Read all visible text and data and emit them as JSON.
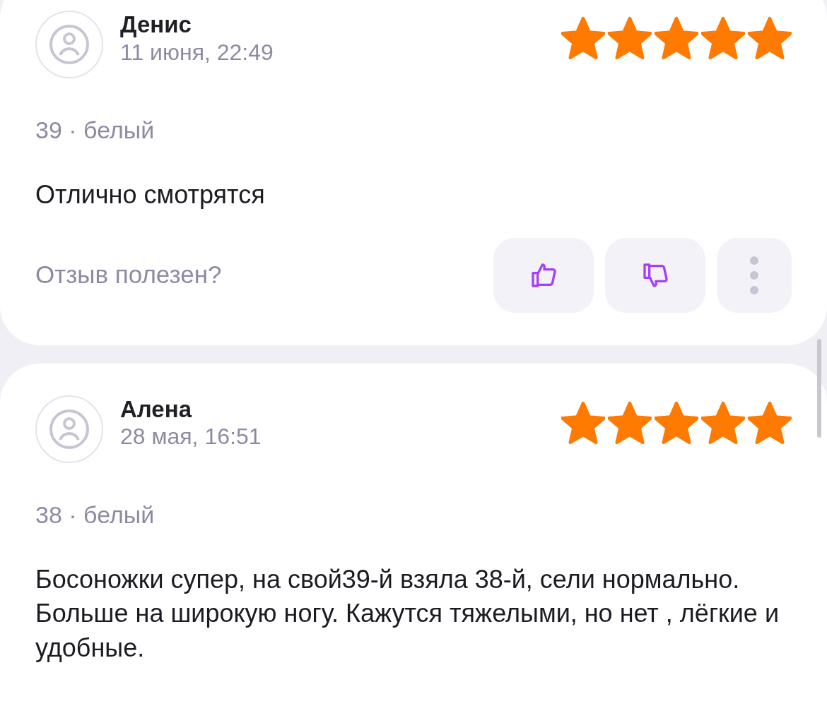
{
  "reviews": [
    {
      "author": "Денис",
      "date": "11 июня, 22:49",
      "stars": 5,
      "variant": "39 · белый",
      "text": "Отлично смотрятся",
      "helpful_prompt": "Отзыв полезен?"
    },
    {
      "author": "Алена",
      "date": "28 мая, 16:51",
      "stars": 5,
      "variant": "38 · белый",
      "text": "Босоножки супер, на свой39-й взяла 38-й, сели нормально. Больше на широкую ногу. Кажутся тяжелыми, но нет , лёгкие и удобные."
    }
  ]
}
